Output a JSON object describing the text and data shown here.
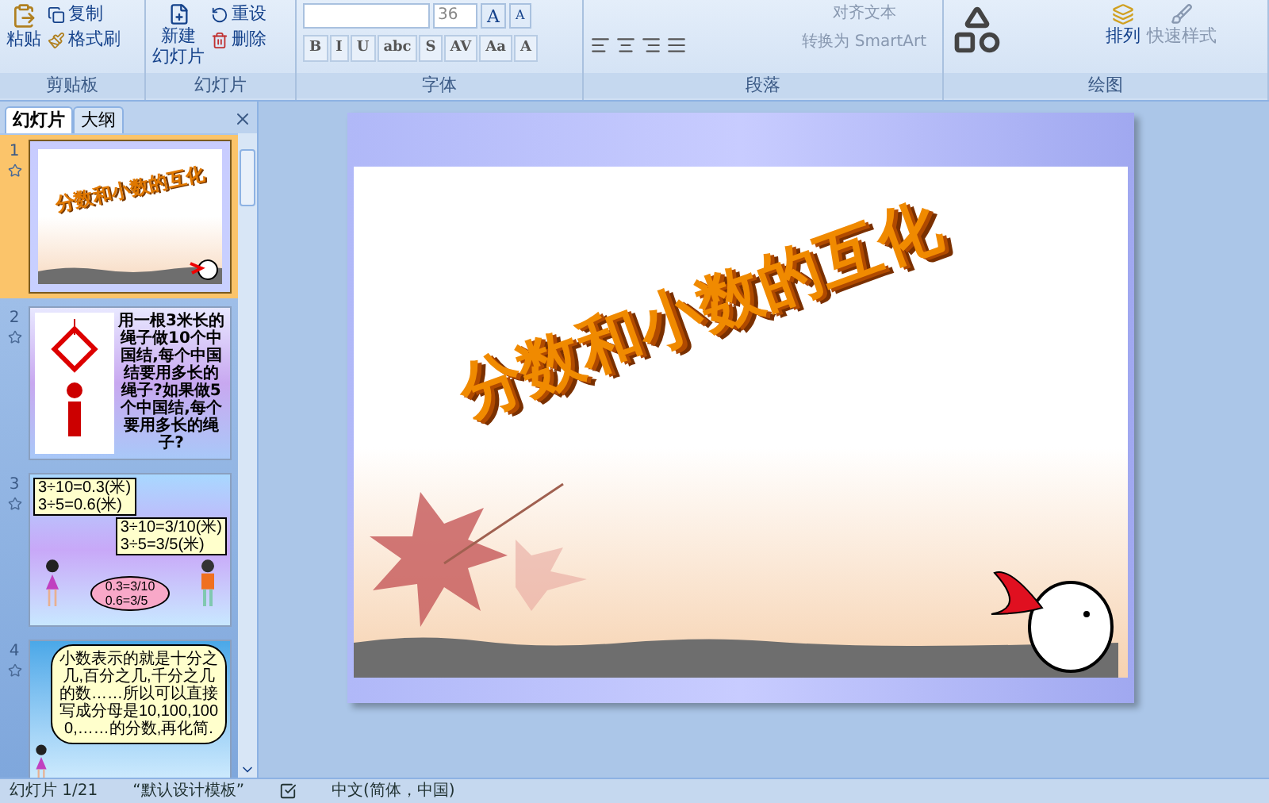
{
  "ribbon": {
    "clipboard": {
      "label": "剪贴板",
      "paste": "粘贴",
      "copy": "复制",
      "format_painter": "格式刷"
    },
    "slides": {
      "label": "幻灯片",
      "new_slide": [
        "新建",
        "幻灯片"
      ],
      "reset": "重设",
      "delete": "删除"
    },
    "font": {
      "label": "字体",
      "font_size": "36",
      "size_buttons": [
        "A",
        "A"
      ],
      "buttons": [
        "B",
        "I",
        "U",
        "abc",
        "S",
        "AV",
        "Aa",
        "A"
      ]
    },
    "paragraph": {
      "label": "段落",
      "align_text": "对齐文本",
      "smartart": "转换为 SmartArt"
    },
    "drawing": {
      "label": "绘图",
      "arrange": "排列",
      "quick_styles": "快速样式"
    }
  },
  "pane": {
    "tabs": [
      {
        "label": "幻灯片",
        "selected": true
      },
      {
        "label": "大纲",
        "selected": false
      }
    ],
    "thumbnails": [
      {
        "number": "1",
        "selected": true,
        "kind": "title",
        "title": "分数和小数的互化"
      },
      {
        "number": "2",
        "selected": false,
        "kind": "knot",
        "text": "用一根3米长的绳子做10个中国结,每个中国结要用多长的绳子?如果做5个中国结,每个要用多长的绳子?"
      },
      {
        "number": "3",
        "selected": false,
        "kind": "dialog",
        "left": [
          "3÷10=0.3(米)",
          "3÷5=0.6(米)"
        ],
        "right": [
          "3÷10=3/10(米)",
          "3÷5=3/5(米)"
        ],
        "center": [
          "0.3=3/10",
          "0.6=3/5"
        ]
      },
      {
        "number": "4",
        "selected": false,
        "kind": "cloud",
        "text": "小数表示的就是十分之几,百分之几,千分之几的数……所以可以直接写成分母是10,100,1000,……的分数,再化简."
      }
    ]
  },
  "slide": {
    "title": "分数和小数的互化"
  },
  "status_bar": {
    "position": "幻灯片 1/21",
    "theme": "“默认设计模板”",
    "language": "中文(简体，中国)"
  }
}
